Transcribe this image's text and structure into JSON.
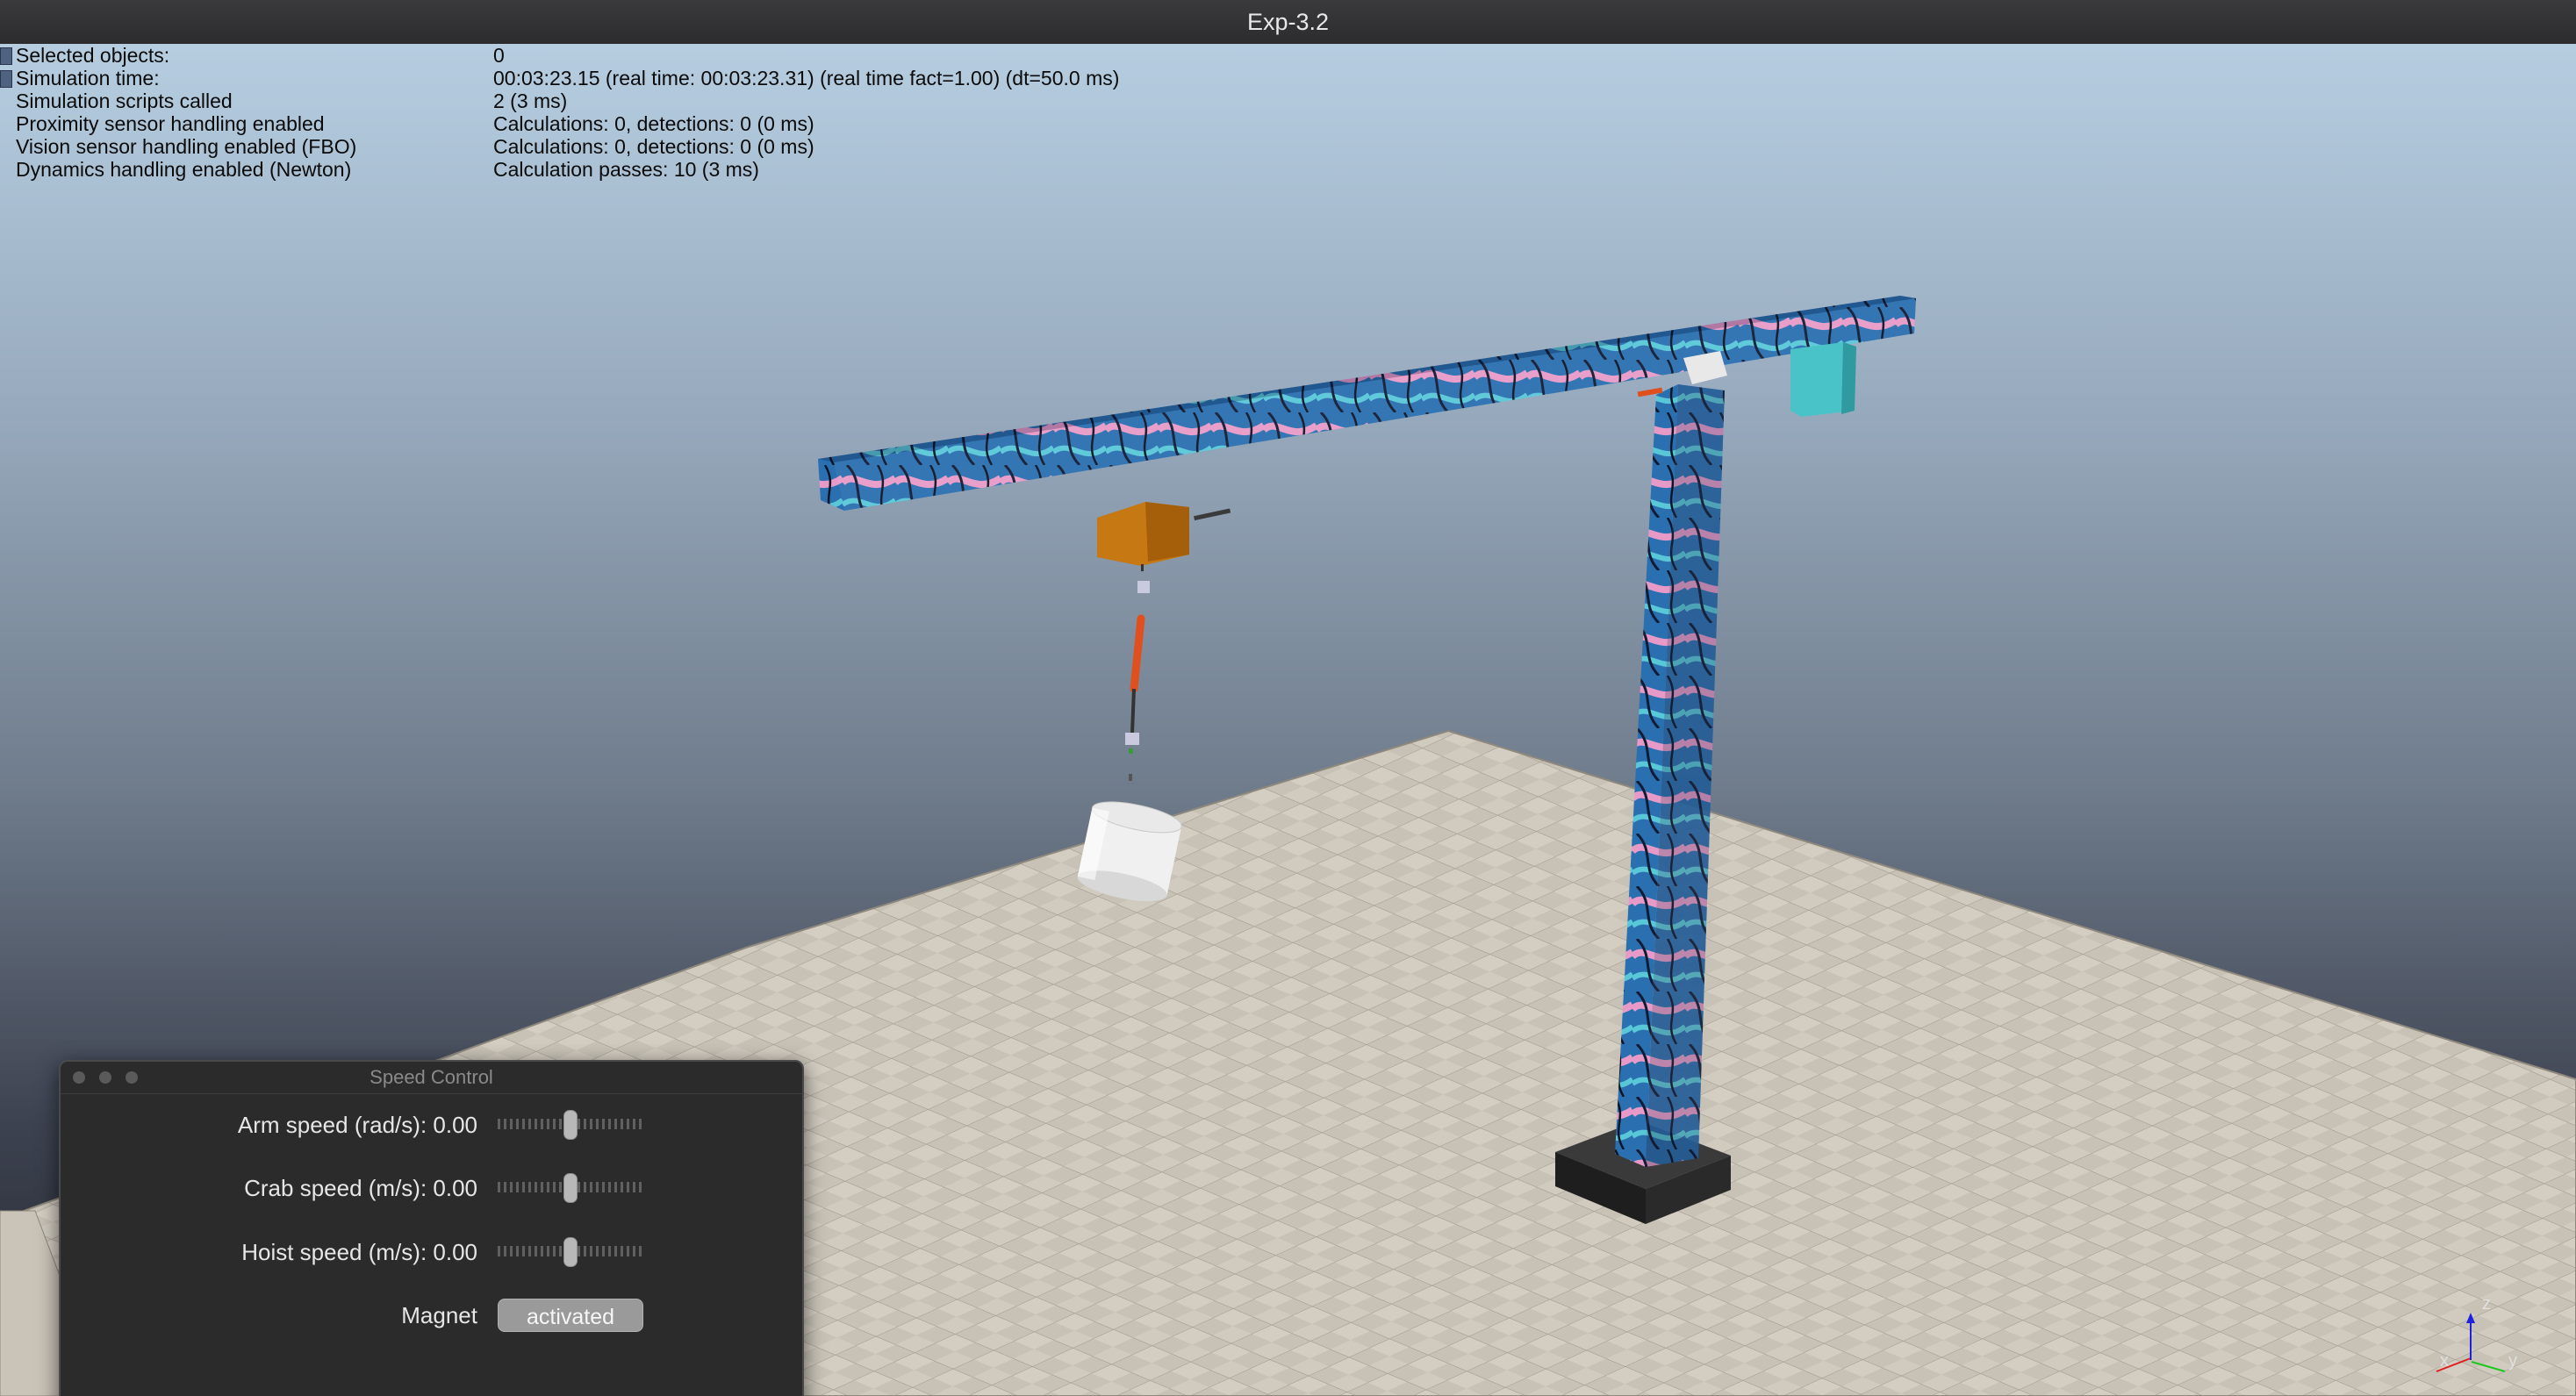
{
  "window": {
    "title": "Exp-3.2"
  },
  "info_panel": {
    "rows": [
      {
        "label": "Selected objects:",
        "value": "0"
      },
      {
        "label": "Simulation time:",
        "value": "00:03:23.15 (real time: 00:03:23.31) (real time fact=1.00) (dt=50.0 ms)"
      },
      {
        "label": "Simulation scripts called",
        "value": "2 (3 ms)"
      },
      {
        "label": "Proximity sensor handling enabled",
        "value": "Calculations: 0, detections: 0 (0 ms)"
      },
      {
        "label": "Vision sensor handling enabled (FBO)",
        "value": "Calculations: 0, detections: 0 (0 ms)"
      },
      {
        "label": "Dynamics handling enabled (Newton)",
        "value": "Calculation passes: 10 (3 ms)"
      }
    ]
  },
  "speed_control": {
    "title": "Speed Control",
    "arm": {
      "label": "Arm speed (rad/s): 0.00",
      "level": 0.5
    },
    "crab": {
      "label": "Crab speed (m/s): 0.00",
      "level": 0.5
    },
    "hoist": {
      "label": "Hoist speed (m/s): 0.00",
      "level": 0.5
    },
    "magnet": {
      "label": "Magnet",
      "button": "activated"
    }
  },
  "axes_gizmo": {
    "x": "x",
    "y": "y",
    "z": "z"
  },
  "colors": {
    "beam": "#2a6fb0",
    "trolley": "#c67812",
    "cable": "#e0501f",
    "counterweight": "#4ac3c8",
    "floor": "#c9c3b8"
  }
}
